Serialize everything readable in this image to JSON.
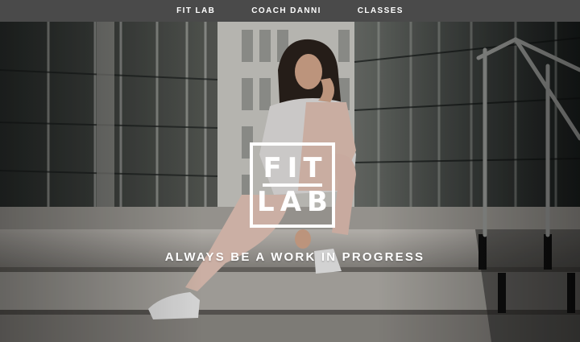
{
  "nav": {
    "items": [
      {
        "label": "FIT LAB"
      },
      {
        "label": "COACH DANNI"
      },
      {
        "label": "CLASSES"
      }
    ]
  },
  "hero": {
    "logo": {
      "line1": "FIT",
      "line2": "LAB"
    },
    "tagline": "ALWAYS BE A WORK IN PROGRESS"
  },
  "colors": {
    "nav_background": "#4a4a4a",
    "nav_text": "#ffffff",
    "overlay_text": "#ffffff"
  }
}
